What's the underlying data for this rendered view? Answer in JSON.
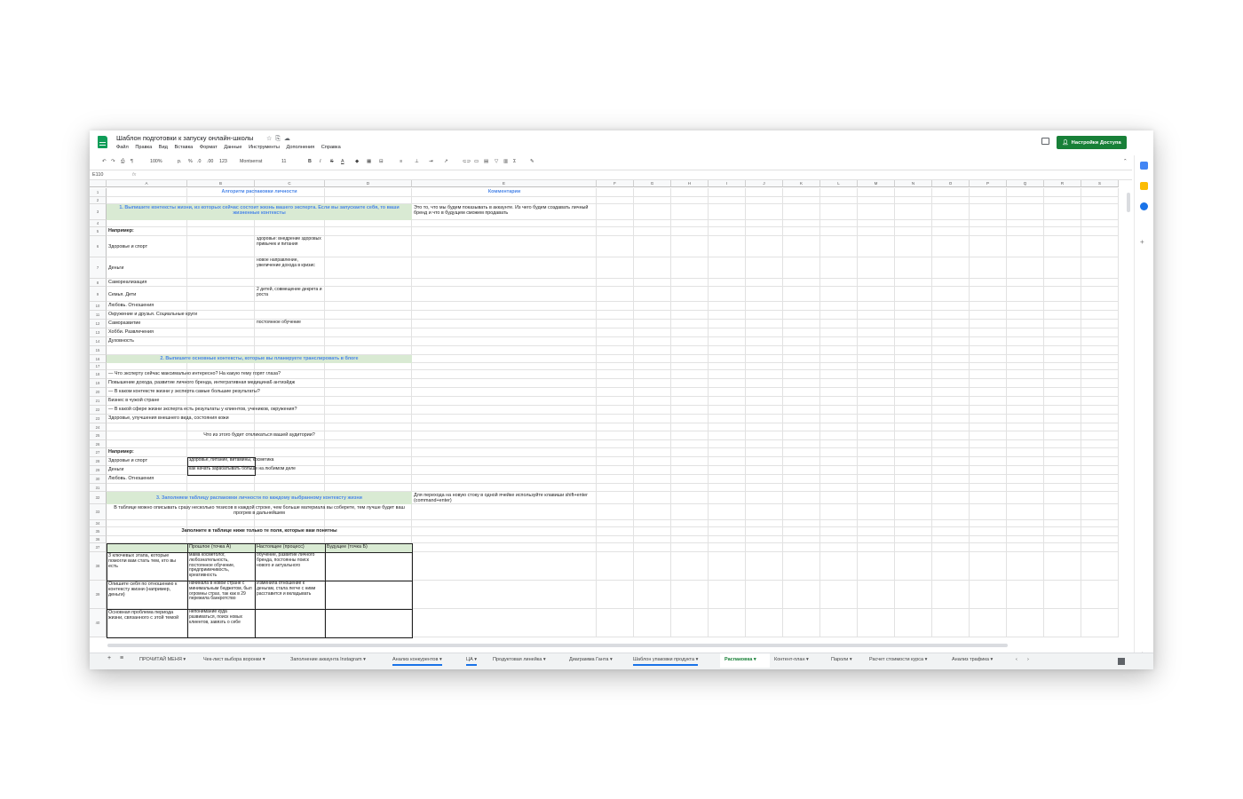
{
  "doc": {
    "title": "Шаблон подготовки к запуску онлайн-школы",
    "menu": [
      "Файл",
      "Правка",
      "Вид",
      "Вставка",
      "Формат",
      "Данные",
      "Инструменты",
      "Дополнения",
      "Справка"
    ],
    "share_label": "Настройки Доступа"
  },
  "toolbar": {
    "zoom": "100%",
    "currency": "р.",
    "percent": "%",
    "dec_less": ".0",
    "dec_more": ".00",
    "format_more": "123",
    "font": "Montserrat",
    "font_size": "11",
    "bold": "B",
    "italic": "I",
    "strike": "S",
    "text_color": "A",
    "sum": "Σ"
  },
  "formula_bar": {
    "cell": "E110",
    "fx": "fx"
  },
  "columns": [
    "A",
    "B",
    "C",
    "D",
    "E",
    "F",
    "G",
    "H",
    "I",
    "J",
    "K",
    "L",
    "M",
    "N",
    "O",
    "P",
    "Q",
    "R",
    "S"
  ],
  "rows": [
    "1",
    "2",
    "3",
    "4",
    "5",
    "6",
    "7",
    "8",
    "9",
    "10",
    "11",
    "12",
    "13",
    "14",
    "15",
    "16",
    "17",
    "18",
    "19",
    "20",
    "21",
    "22",
    "23",
    "24",
    "25",
    "26",
    "27",
    "28",
    "29",
    "30",
    "31",
    "32",
    "33",
    "34",
    "35",
    "36",
    "37",
    "38",
    "39",
    "40"
  ],
  "cells": {
    "r1_title": "Алгоритм распаковки личности",
    "r1_comments": "Комментарии",
    "r3_heading": "1. Выпишите контексты жизни, из которых сейчас состоит жизнь вашего эксперта. Если вы запускаете себя, то ваши жизненные контексты",
    "r3_comment": "Это то, что мы будем показывать в аккаунте. Из чего будем создавать личный бренд и что в будущем сможем продавать",
    "r5": "Например:",
    "r6_a": "Здоровье и спорт",
    "r6_c": "здоровье: внедрение здоровых привычек и питания",
    "r7_a": "Деньги",
    "r7_c": "новое направление, увеличение дохода в кризис",
    "r8_a": "Самореализация",
    "r9_a": "Семья. Дети",
    "r9_c": "2 детей, совмещение декрета и роста",
    "r10_a": "Любовь. Отношения",
    "r11_a": "Окружение и друзья. Социальные круги",
    "r12_a": "Саморазвитие",
    "r12_c": "постоянное обучение",
    "r13_a": "Хобби. Развлечения",
    "r14_a": "Духовность",
    "r16_heading": "2. Выпишите основные контексты, которые вы планируете транслировать в блоге",
    "r18": "— Что эксперту сейчас максимально интересно? На какую тему горят глаза?",
    "r19": "Повышение дохода, развитие личного бренда, интегративная медицина6 антиэйдж",
    "r20": "— В каком контексте жизни у эксперта самые большие результаты?",
    "r21": "Бизнес в чужой стране",
    "r22": "— В какой сфере жизни эксперта есть результаты у клиентов, учеников, окружения?",
    "r23": "Здоровье, улучшения внешнего вида, состояния кожи",
    "r25": "Что из этого будет откликаться вашей аудитории?",
    "r27": "Например:",
    "r28_a": "Здоровье и спорт",
    "r28_b": "здоровье, питание, витамины, косметика",
    "r29_a": "Деньги",
    "r29_b": "как начать зарабатывать больше на любимом деле",
    "r30_a": "Любовь. Отношения",
    "r32_heading": "3. Заполняем таблицу распаковки личности по каждому выбранному контексту жизни",
    "r32_comment": "Для перехода на новую стоку в одной ячейке используйте клавиши shift+enter (command+enter)",
    "r33": "В таблице можно описывать сразу несколько тезисов в каждой строке, чем больше материала вы соберете, тем лучше будет ваш прогрев в дальнейшем",
    "r35": "Заполните в таблице ниже только те поля, которые вам понятны",
    "r37_b": "Прошлое (точка А)",
    "r37_c": "Настоящее (процесс)",
    "r37_d": "Будущее (точка Б)",
    "r38_a": "3 ключевых этапа, которые помогли вам стать тем, кто вы есть",
    "r38_b": "мама косметолог, любознательность, постоянное обучение, предприимчивость, креативность",
    "r38_c": "обучение, развитие личного бренда, постоянны поиск нового и актуального",
    "r39_a": "Опишите себя по отношению к контексту жизни (например, деньги)",
    "r39_b": "начинала в новой стране с минимальным бюджетом, был огромны страх, так как в 29 пережила банкротство",
    "r39_c": "Изменила отношение к деньгам, стала легче с ними расставится и вкладывать",
    "r40_a": "Основная проблема периода жизни, связанного с этой темой",
    "r40_b": "непонимание куда развиваться, поиск новых клиентов, завязть о себе"
  },
  "tabs": [
    {
      "label": "ПРОЧИТАЙ МЕНЯ"
    },
    {
      "label": "Чек-лист выбора воронки"
    },
    {
      "label": "Заполнение аккаунта Instagram"
    },
    {
      "label": "Анализ конкурентов"
    },
    {
      "label": "ЦА"
    },
    {
      "label": "Продуктовая линейка"
    },
    {
      "label": "Диаграмма Ганта"
    },
    {
      "label": "Шаблон упаковки продукта"
    },
    {
      "label": "Распаковка"
    },
    {
      "label": "Контент-план"
    },
    {
      "label": "Пароли"
    },
    {
      "label": "Расчет стоимости курса"
    },
    {
      "label": "Анализ трафика"
    }
  ],
  "colors": {
    "green_fill": "#d9ead3",
    "heading_blue": "#4a86e8",
    "share_green": "#188038"
  }
}
